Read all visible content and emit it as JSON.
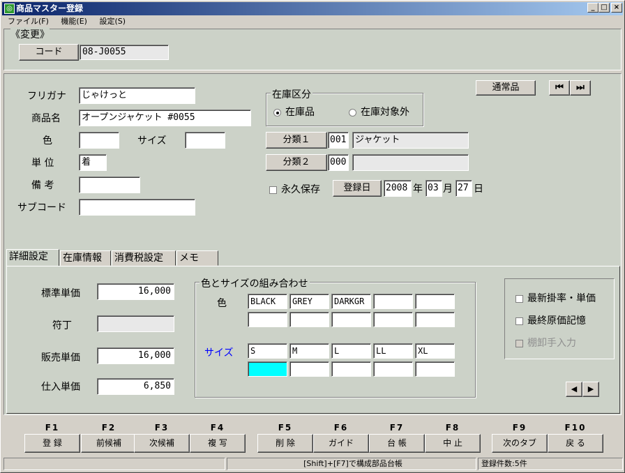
{
  "window": {
    "title": "商品マスター登録",
    "icon": "app-icon"
  },
  "menu": [
    "ファイル(F)",
    "機能(E)",
    "設定(S)"
  ],
  "mode_label": "《変更》",
  "code": {
    "label": "コード",
    "value": "08-J0055"
  },
  "item_type_button": "通常品",
  "form": {
    "furigana": {
      "label": "フリガナ",
      "value": "じゃけっと"
    },
    "name": {
      "label": "商品名",
      "value": "オープンジャケット #0055"
    },
    "color": {
      "label": "色",
      "value": ""
    },
    "size": {
      "label": "サイズ",
      "value": ""
    },
    "unit": {
      "label": "単 位",
      "value": "着"
    },
    "memo": {
      "label": "備 考",
      "value": ""
    },
    "subcode": {
      "label": "サブコード",
      "value": ""
    }
  },
  "stock_type": {
    "caption": "在庫区分",
    "options": [
      "在庫品",
      "在庫対象外"
    ],
    "selected": 0
  },
  "category1": {
    "label": "分類１",
    "code": "001",
    "name": "ジャケット"
  },
  "category2": {
    "label": "分類２",
    "code": "000",
    "name": ""
  },
  "permanent": {
    "label": "永久保存",
    "checked": false
  },
  "reg_date": {
    "label": "登録日",
    "year": "2008",
    "year_unit": "年",
    "month": "03",
    "month_unit": "月",
    "day": "27",
    "day_unit": "日"
  },
  "tabs": [
    "詳細設定",
    "在庫情報",
    "消費税設定",
    "メモ"
  ],
  "active_tab": 0,
  "prices": {
    "standard": {
      "label": "標準単価",
      "value": "16,000"
    },
    "code": {
      "label": "符丁",
      "value": ""
    },
    "sale": {
      "label": "販売単価",
      "value": "16,000"
    },
    "purchase": {
      "label": "仕入単価",
      "value": "6,850"
    }
  },
  "combo": {
    "caption": "色とサイズの組み合わせ",
    "color_label": "色",
    "size_label": "サイズ",
    "colors": [
      "BLACK",
      "GREY",
      "DARKGR",
      "",
      ""
    ],
    "color_row2": [
      "",
      "",
      "",
      "",
      ""
    ],
    "sizes": [
      "S",
      "M",
      "L",
      "LL",
      "XL"
    ],
    "size_row2": [
      "",
      "",
      "",
      "",
      ""
    ]
  },
  "options": [
    {
      "label": "最新掛率・単価",
      "checked": false,
      "enabled": true
    },
    {
      "label": "最終原価記憶",
      "checked": false,
      "enabled": true
    },
    {
      "label": "棚卸手入力",
      "checked": false,
      "enabled": false
    }
  ],
  "fkeys": [
    {
      "key": "F1",
      "label": "登 録"
    },
    {
      "key": "F2",
      "label": "前候補"
    },
    {
      "key": "F3",
      "label": "次候補"
    },
    {
      "key": "F4",
      "label": "複 写"
    },
    {
      "key": "F5",
      "label": "削 除"
    },
    {
      "key": "F6",
      "label": "ガイド"
    },
    {
      "key": "F7",
      "label": "台 帳"
    },
    {
      "key": "F8",
      "label": "中 止"
    },
    {
      "key": "F9",
      "label": "次のタブ"
    },
    {
      "key": "F10",
      "label": "戻 る"
    }
  ],
  "status": {
    "hint": "[Shift]+[F7]で構成部品台帳",
    "count": "登録件数:5件"
  },
  "colors": {
    "title_start": "#0a246a",
    "title_end": "#a6caf0",
    "panel_bg": "#ccd2c8",
    "highlight_cell": "#00ffff",
    "size_label": "#0000ff"
  }
}
